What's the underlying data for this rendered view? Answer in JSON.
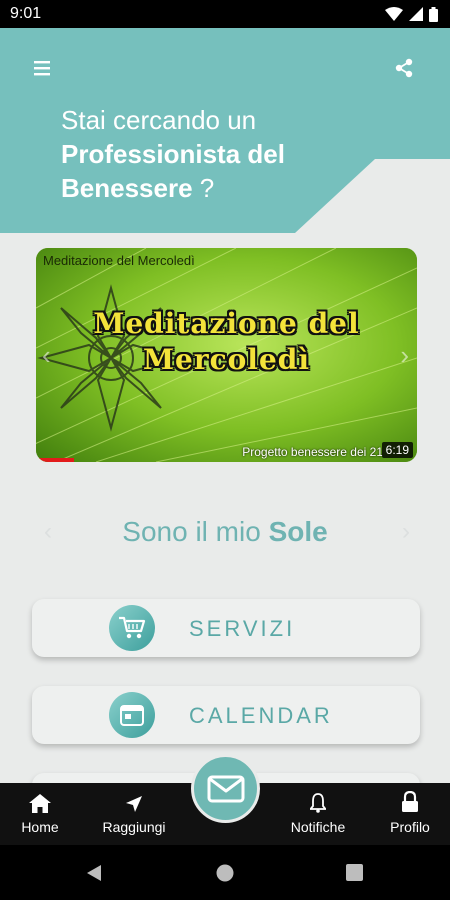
{
  "status": {
    "time": "9:01"
  },
  "header": {
    "line1": "Stai cercando un",
    "line2_bold": "Professionista del",
    "line3_bold": "Benessere",
    "line3_suffix": " ?",
    "bg_color": "#76c0bd"
  },
  "video": {
    "top_title": "Meditazione del Mercoledì",
    "main_title_line1": "Meditazione del",
    "main_title_line2": "Mercoledì",
    "footer_text": "Progetto benessere dei 21",
    "duration": "6:19"
  },
  "subtitle": {
    "prefix": "Sono il mio ",
    "bold": "Sole"
  },
  "menu": [
    {
      "label": "SERVIZI",
      "icon": "cart-icon"
    },
    {
      "label": "CALENDAR",
      "icon": "calendar-icon"
    }
  ],
  "bottom_nav": [
    {
      "label": "Home",
      "icon": "home-icon"
    },
    {
      "label": "Raggiungi",
      "icon": "navigation-arrow-icon"
    },
    {
      "label": "Notifiche",
      "icon": "bell-icon"
    },
    {
      "label": "Profilo",
      "icon": "lock-icon"
    }
  ],
  "fab": {
    "icon": "mail-icon"
  },
  "colors": {
    "accent": "#6fb3b2",
    "header": "#76c0bd",
    "nav_bg": "#111111"
  }
}
